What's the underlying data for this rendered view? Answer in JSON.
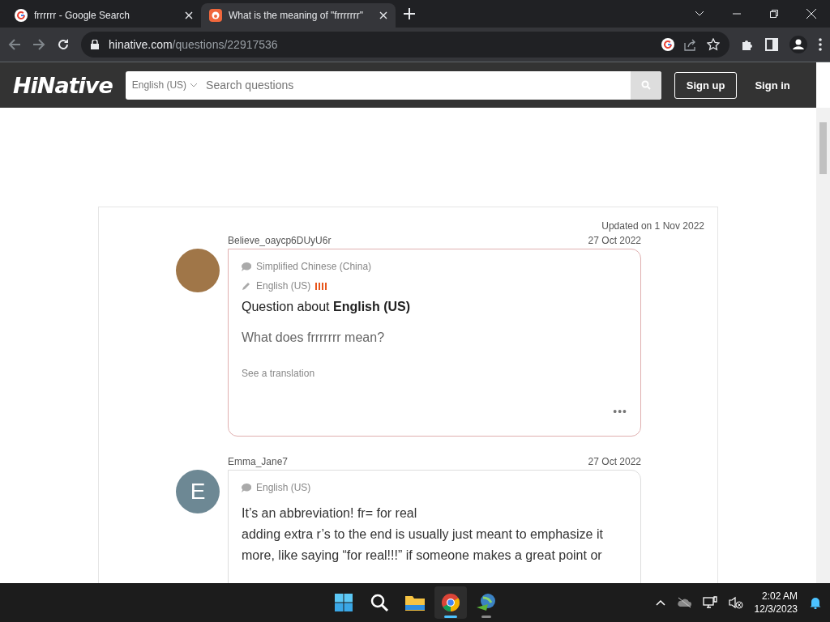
{
  "browser": {
    "tabs": [
      {
        "title": "frrrrrr - Google Search",
        "selected": false
      },
      {
        "title": "What is the meaning of \"frrrrrrr\"",
        "selected": true
      }
    ],
    "address": {
      "domain": "hinative.com",
      "path": "/questions/22917536"
    }
  },
  "header": {
    "logo": "HiNative",
    "language": "English (US)",
    "search_placeholder": "Search questions",
    "sign_up": "Sign up",
    "sign_in": "Sign in"
  },
  "question": {
    "updated": "Updated on 1 Nov 2022",
    "posts": [
      {
        "kind": "question",
        "author": "Believe_oaycp6DUyU6r",
        "date": "27 Oct 2022",
        "native": "Simplified Chinese (China)",
        "learning": "English (US)",
        "level": 1,
        "heading": "Question about **English (US)**",
        "body": "What does frrrrrrr mean?",
        "translate": "See a translation",
        "more": "•••"
      },
      {
        "kind": "answer",
        "author": "Emma_Jane7",
        "date": "27 Oct 2022",
        "avatar": "E",
        "native": "English (US)",
        "body_lines": [
          "It’s an abbreviation! fr= for real",
          "adding extra r’s to the end is usually just meant to emphasize it",
          "more, like saying “for real!!!” if someone makes a great point or"
        ]
      }
    ]
  },
  "taskbar": {
    "apps": [
      {
        "running": false
      },
      {
        "running": false
      },
      {
        "running": false
      },
      {
        "running": true,
        "selected": true
      },
      {
        "running": true,
        "selected": false
      }
    ],
    "time": "2:02 AM",
    "date": "12/3/2023"
  }
}
